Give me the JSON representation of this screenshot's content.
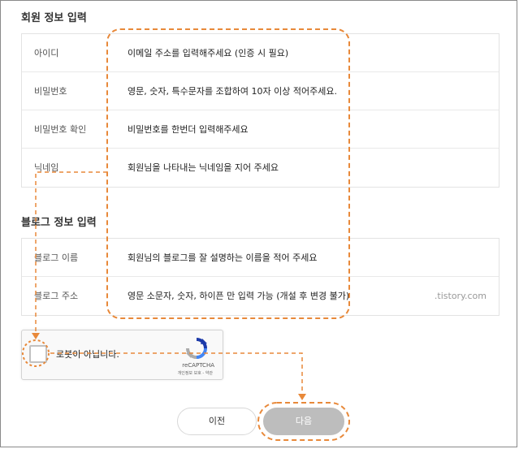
{
  "member_section": {
    "title": "회원 정보 입력",
    "rows": [
      {
        "label": "아이디",
        "value": "이메일 주소를 입력해주세요 (인증 시 필요)"
      },
      {
        "label": "비밀번호",
        "value": "영문, 숫자, 특수문자를 조합하여 10자 이상 적어주세요."
      },
      {
        "label": "비밀번호 확인",
        "value": "비밀번호를 한번더 입력해주세요"
      },
      {
        "label": "닉네임",
        "value": "회원님을 나타내는 닉네임을 지어 주세요"
      }
    ]
  },
  "blog_section": {
    "title": "블로그 정보 입력",
    "rows": [
      {
        "label": "블로그 이름",
        "value": "회원님의 블로그를 잘 설명하는 이름을 적어 주세요",
        "suffix": ""
      },
      {
        "label": "블로그 주소",
        "value": "영문 소문자, 숫자, 하이픈 만 입력 가능 (개설 후 변경 불가)",
        "suffix": ".tistory.com"
      }
    ]
  },
  "captcha": {
    "label": "로봇이 아닙니다.",
    "brand": "reCAPTCHA",
    "links": "개인정보 보호 - 약관"
  },
  "buttons": {
    "prev": "이전",
    "next": "다음"
  },
  "colors": {
    "annotation": "#e8893a",
    "next_button": "#bdbdbd"
  }
}
